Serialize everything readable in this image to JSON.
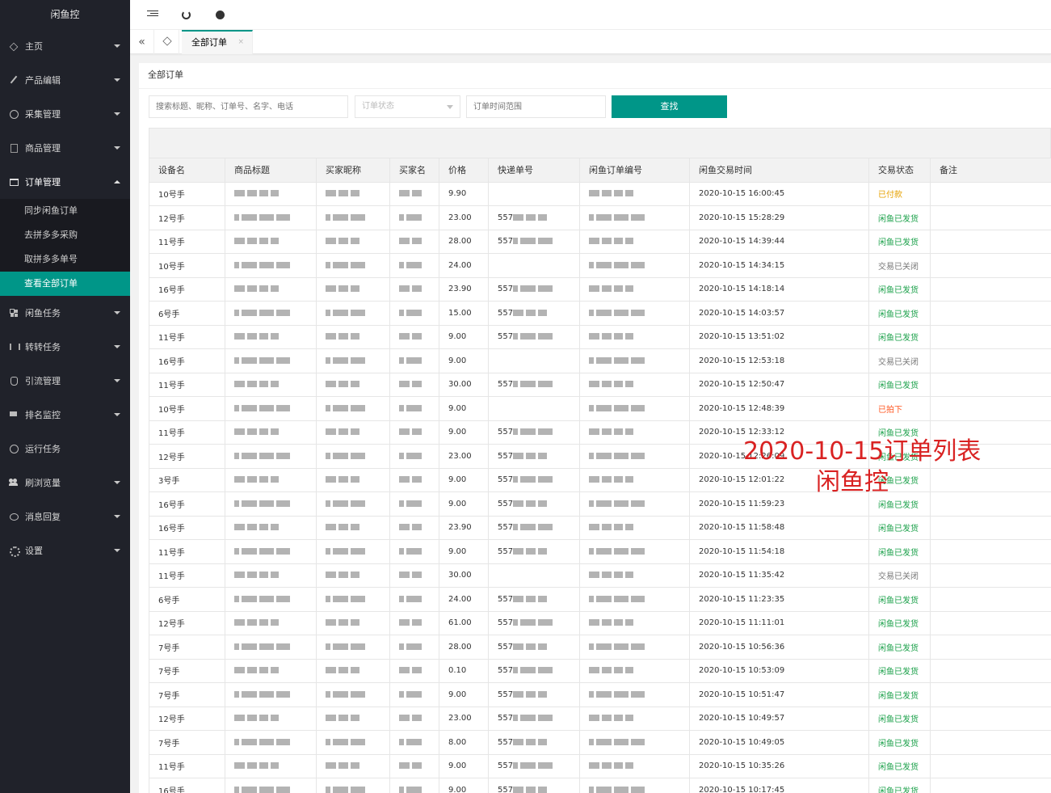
{
  "app": {
    "logo": "闲鱼控"
  },
  "sidebar": {
    "items": [
      {
        "label": "主页",
        "icon": "home-icon",
        "expanded": false
      },
      {
        "label": "产品编辑",
        "icon": "pen-icon",
        "expanded": false
      },
      {
        "label": "采集管理",
        "icon": "collect-icon",
        "expanded": false
      },
      {
        "label": "商品管理",
        "icon": "doc-icon",
        "expanded": false
      },
      {
        "label": "订单管理",
        "icon": "cart-icon",
        "expanded": true
      },
      {
        "label": "闲鱼任务",
        "icon": "grid-icon",
        "expanded": false
      },
      {
        "label": "转转任务",
        "icon": "bars-icon",
        "expanded": false
      },
      {
        "label": "引流管理",
        "icon": "hand-icon",
        "expanded": false
      },
      {
        "label": "排名监控",
        "icon": "monitor-icon",
        "expanded": false
      },
      {
        "label": "运行任务",
        "icon": "clock-icon",
        "expanded": false
      },
      {
        "label": "刷浏览量",
        "icon": "users-icon",
        "expanded": false
      },
      {
        "label": "消息回复",
        "icon": "chat-icon",
        "expanded": false
      },
      {
        "label": "设置",
        "icon": "gear-icon",
        "expanded": false
      }
    ],
    "order_subitems": [
      "同步闲鱼订单",
      "去拼多多采购",
      "取拼多多单号",
      "查看全部订单"
    ],
    "active_subitem": "查看全部订单"
  },
  "header": {
    "icons": [
      "menu-fold-icon",
      "refresh-icon",
      "chat-icon"
    ]
  },
  "tabs": {
    "active": "全部订单",
    "close": "×"
  },
  "panel": {
    "title": "全部订单",
    "search_placeholder": "搜索标题、昵称、订单号、名字、电话",
    "status_placeholder": "订单状态",
    "range_placeholder": "订单时间范围",
    "find_button": "查找"
  },
  "table": {
    "columns": [
      "设备名",
      "商品标题",
      "买家昵称",
      "买家名",
      "价格",
      "快递单号",
      "闲鱼订单编号",
      "闲鱼交易时间",
      "交易状态",
      "备注"
    ],
    "rows": [
      {
        "device": "10号手",
        "price": "9.90",
        "express": "",
        "time": "2020-10-15 16:00:45",
        "status": "已付款",
        "status_class": "st-paid"
      },
      {
        "device": "12号手",
        "price": "23.00",
        "express": "557",
        "time": "2020-10-15 15:28:29",
        "status": "闲鱼已发货",
        "status_class": "st-shipped"
      },
      {
        "device": "11号手",
        "price": "28.00",
        "express": "557",
        "time": "2020-10-15 14:39:44",
        "status": "闲鱼已发货",
        "status_class": "st-shipped"
      },
      {
        "device": "10号手",
        "price": "24.00",
        "express": "",
        "time": "2020-10-15 14:34:15",
        "status": "交易已关闭",
        "status_class": "st-closed"
      },
      {
        "device": "16号手",
        "price": "23.90",
        "express": "557",
        "time": "2020-10-15 14:18:14",
        "status": "闲鱼已发货",
        "status_class": "st-shipped"
      },
      {
        "device": "6号手",
        "price": "15.00",
        "express": "557",
        "time": "2020-10-15 14:03:57",
        "status": "闲鱼已发货",
        "status_class": "st-shipped"
      },
      {
        "device": "11号手",
        "price": "9.00",
        "express": "557",
        "time": "2020-10-15 13:51:02",
        "status": "闲鱼已发货",
        "status_class": "st-shipped"
      },
      {
        "device": "16号手",
        "price": "9.00",
        "express": "",
        "time": "2020-10-15 12:53:18",
        "status": "交易已关闭",
        "status_class": "st-closed"
      },
      {
        "device": "11号手",
        "price": "30.00",
        "express": "557",
        "time": "2020-10-15 12:50:47",
        "status": "闲鱼已发货",
        "status_class": "st-shipped"
      },
      {
        "device": "10号手",
        "price": "9.00",
        "express": "",
        "time": "2020-10-15 12:48:39",
        "status": "已拍下",
        "status_class": "st-taken"
      },
      {
        "device": "11号手",
        "price": "9.00",
        "express": "557",
        "time": "2020-10-15 12:33:12",
        "status": "闲鱼已发货",
        "status_class": "st-shipped"
      },
      {
        "device": "12号手",
        "price": "23.00",
        "express": "557",
        "time": "2020-10-15 12:26:09",
        "status": "闲鱼已发货",
        "status_class": "st-shipped"
      },
      {
        "device": "3号手",
        "price": "9.00",
        "express": "557",
        "time": "2020-10-15 12:01:22",
        "status": "闲鱼已发货",
        "status_class": "st-shipped"
      },
      {
        "device": "16号手",
        "price": "9.00",
        "express": "557",
        "time": "2020-10-15 11:59:23",
        "status": "闲鱼已发货",
        "status_class": "st-shipped"
      },
      {
        "device": "16号手",
        "price": "23.90",
        "express": "557",
        "time": "2020-10-15 11:58:48",
        "status": "闲鱼已发货",
        "status_class": "st-shipped"
      },
      {
        "device": "11号手",
        "price": "9.00",
        "express": "557",
        "time": "2020-10-15 11:54:18",
        "status": "闲鱼已发货",
        "status_class": "st-shipped"
      },
      {
        "device": "11号手",
        "price": "30.00",
        "express": "",
        "time": "2020-10-15 11:35:42",
        "status": "交易已关闭",
        "status_class": "st-closed"
      },
      {
        "device": "6号手",
        "price": "24.00",
        "express": "557",
        "time": "2020-10-15 11:23:35",
        "status": "闲鱼已发货",
        "status_class": "st-shipped"
      },
      {
        "device": "12号手",
        "price": "61.00",
        "express": "557",
        "time": "2020-10-15 11:11:01",
        "status": "闲鱼已发货",
        "status_class": "st-shipped"
      },
      {
        "device": "7号手",
        "price": "28.00",
        "express": "557",
        "time": "2020-10-15 10:56:36",
        "status": "闲鱼已发货",
        "status_class": "st-shipped"
      },
      {
        "device": "7号手",
        "price": "0.10",
        "express": "557",
        "time": "2020-10-15 10:53:09",
        "status": "闲鱼已发货",
        "status_class": "st-shipped"
      },
      {
        "device": "7号手",
        "price": "9.00",
        "express": "557",
        "time": "2020-10-15 10:51:47",
        "status": "闲鱼已发货",
        "status_class": "st-shipped"
      },
      {
        "device": "12号手",
        "price": "23.00",
        "express": "557",
        "time": "2020-10-15 10:49:57",
        "status": "闲鱼已发货",
        "status_class": "st-shipped"
      },
      {
        "device": "7号手",
        "price": "8.00",
        "express": "557",
        "time": "2020-10-15 10:49:05",
        "status": "闲鱼已发货",
        "status_class": "st-shipped"
      },
      {
        "device": "11号手",
        "price": "9.00",
        "express": "557",
        "time": "2020-10-15 10:35:26",
        "status": "闲鱼已发货",
        "status_class": "st-shipped"
      },
      {
        "device": "16号手",
        "price": "9.00",
        "express": "557",
        "time": "2020-10-15 10:17:45",
        "status": "闲鱼已发货",
        "status_class": "st-shipped"
      }
    ]
  },
  "watermark": {
    "line1": "2020-10-15订单列表",
    "line2": "闲鱼控"
  },
  "colors": {
    "sidebar_bg": "#20222a",
    "accent": "#009688",
    "paid": "#e6a100",
    "shipped": "#1aa049",
    "closed": "#777777",
    "taken": "#ff5722",
    "watermark": "#d92222"
  }
}
